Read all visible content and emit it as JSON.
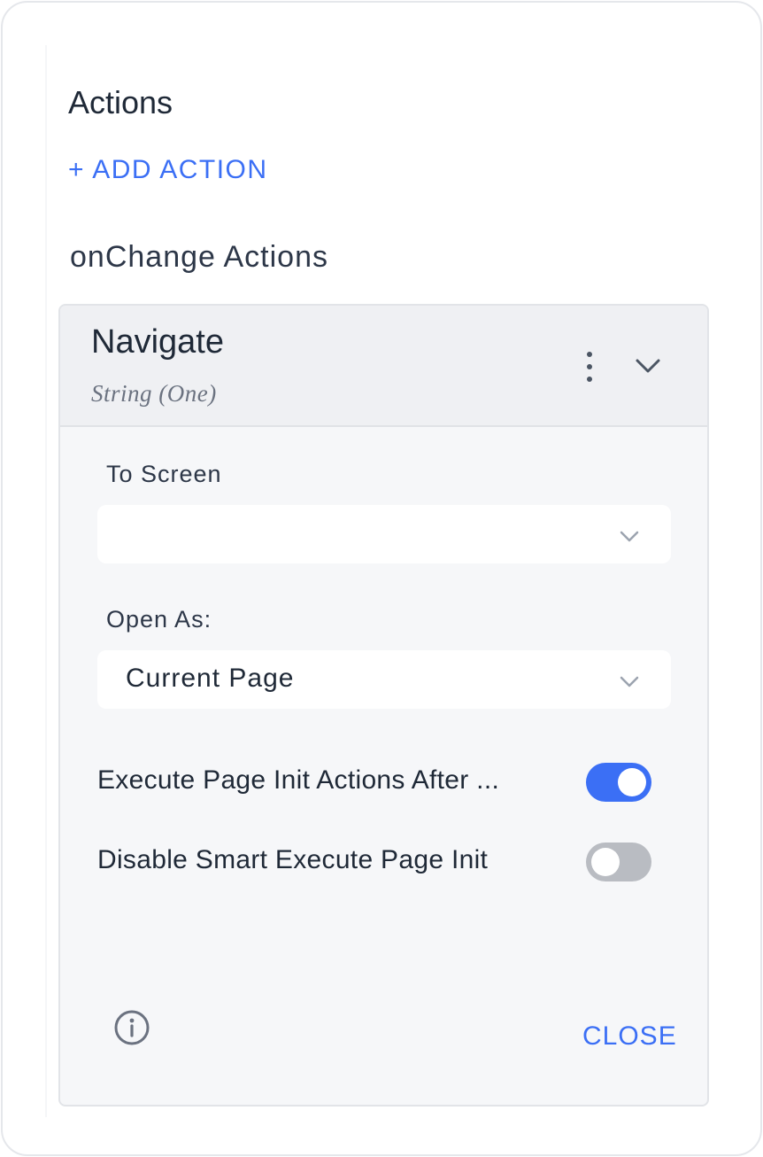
{
  "section": {
    "title": "Actions",
    "add_action_label": "+ ADD ACTION",
    "subsection_title": "onChange Actions"
  },
  "action_card": {
    "title": "Navigate",
    "subtitle": "String (One)",
    "menu_icon": "kebab-icon",
    "collapse_icon": "chevron-down-icon",
    "fields": {
      "to_screen": {
        "label": "To Screen",
        "value": ""
      },
      "open_as": {
        "label": "Open As:",
        "value": "Current Page"
      }
    },
    "toggles": [
      {
        "label": "Execute Page Init Actions After ...",
        "state": "on"
      },
      {
        "label": "Disable Smart Execute Page Init",
        "state": "off"
      }
    ],
    "footer": {
      "info_icon": "info-icon",
      "close_label": "CLOSE"
    }
  },
  "colors": {
    "accent": "#3b6ff5",
    "toggle_off": "#b9bcc2",
    "card_bg": "#f6f7f9",
    "header_bg": "#eff0f3"
  }
}
